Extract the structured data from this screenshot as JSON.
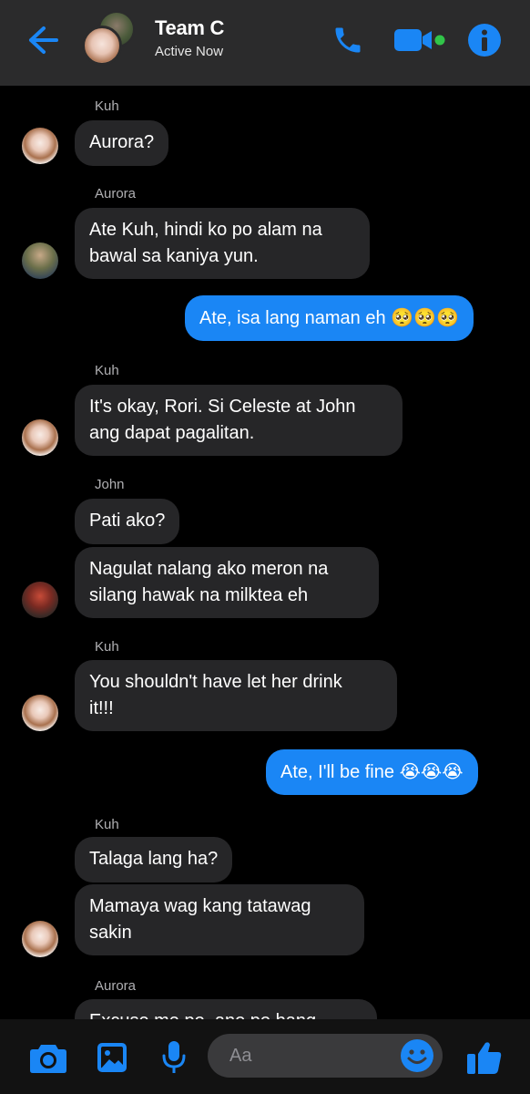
{
  "header": {
    "title": "Team C",
    "status": "Active Now"
  },
  "colors": {
    "accent": "#1a86f5",
    "active_dot": "#31c449",
    "incoming_bubble": "#262628",
    "outgoing_bubble": "#1a86f5",
    "header_bg": "#2b2b2c"
  },
  "icons": {
    "back": "back-arrow-icon",
    "call": "phone-icon",
    "video": "video-camera-icon",
    "info": "info-icon",
    "camera": "camera-icon",
    "gallery": "image-icon",
    "mic": "microphone-icon",
    "emoji": "smiley-icon",
    "like": "thumbs-up-icon"
  },
  "messages": [
    {
      "sender": "Kuh",
      "text": "Aurora?"
    },
    {
      "sender": "Aurora",
      "line1": "Ate Kuh, hindi ko po alam na",
      "line2": "bawal sa kaniya yun."
    },
    {
      "outgoing": true,
      "text": "Ate, isa lang naman eh",
      "emoji": "🥺🥺🥺"
    },
    {
      "sender": "Kuh",
      "line1": "It's okay, Rori. Si Celeste at John",
      "line2": "ang dapat pagalitan."
    },
    {
      "sender": "John",
      "text": "Pati ako?"
    },
    {
      "line1": "Nagulat nalang ako meron na",
      "line2": "silang hawak na milktea eh"
    },
    {
      "sender": "Kuh",
      "line1": "You shouldn't have let her drink",
      "line2": "it!!!"
    },
    {
      "outgoing": true,
      "text": "Ate, I'll be fine",
      "emoji": "😭😭😭"
    },
    {
      "sender": "Kuh",
      "text": "Talaga lang ha?"
    },
    {
      "line1": "Mamaya wag kang tatawag",
      "line2": "sakin"
    },
    {
      "sender": "Aurora",
      "text": "Excuse me po, ano po bang"
    }
  ],
  "composer": {
    "placeholder": "Aa"
  }
}
